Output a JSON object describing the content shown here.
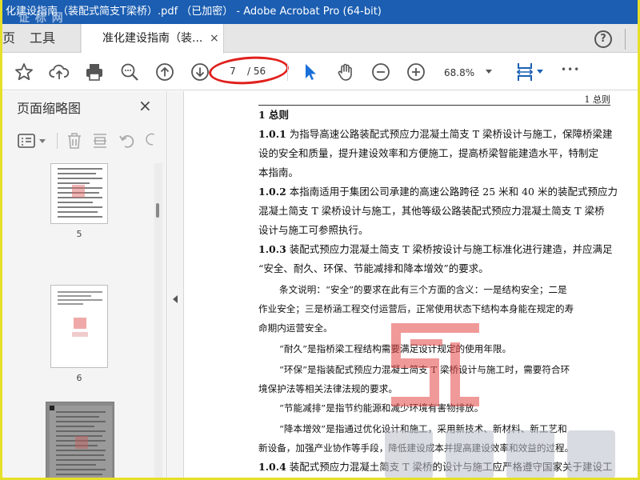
{
  "window": {
    "title": "化建设指南（装配式简支T梁桥）.pdf （已加密） - Adobe Acrobat Pro (64-bit)",
    "watermark": "证 标 网"
  },
  "tabs": {
    "home_label": "页",
    "tools_label": "工具",
    "doc_label": "准化建设指南（装...",
    "close_glyph": "×",
    "help_glyph": "?"
  },
  "toolbar": {
    "icons": [
      "star-icon",
      "upload-icon",
      "print-icon",
      "zoom-search-icon",
      "page-up-icon",
      "page-down-icon",
      "select-arrow-icon",
      "hand-icon",
      "zoom-out-icon",
      "zoom-in-icon",
      "fit-page-icon",
      "more-icon"
    ],
    "page_current": "7",
    "page_total": "/ 56",
    "zoom": "68.8%",
    "more_glyph": "•••"
  },
  "left_panel": {
    "title": "页面缩略图",
    "close_glyph": "×",
    "thumbnails": [
      {
        "label": "5"
      },
      {
        "label": "6"
      },
      {
        "label": ""
      }
    ]
  },
  "document": {
    "running_head": "1  总则",
    "heading": "1 总则",
    "lines": [
      {
        "num": "1.0.1",
        "text": " 为指导高速公路装配式预应力混凝土简支 T 梁桥设计与施工，保障桥梁建"
      },
      {
        "num": "",
        "text": "设的安全和质量，提升建设效率和方便施工，提高桥梁智能建造水平，特制定"
      },
      {
        "num": "",
        "text": "本指南。"
      },
      {
        "num": "1.0.2",
        "text": " 本指南适用于集团公司承建的高速公路跨径 25 米和 40 米的装配式预应力"
      },
      {
        "num": "",
        "text": "混凝土简支 T 梁桥设计与施工，其他等级公路装配式预应力混凝土简支 T 梁桥"
      },
      {
        "num": "",
        "text": "设计与施工可参照执行。"
      },
      {
        "num": "1.0.3",
        "text": " 装配式预应力混凝土简支 T 梁桥按设计与施工标准化进行建造，并应满足"
      },
      {
        "num": "",
        "text": "“安全、耐久、环保、节能减排和降本增效”的要求。"
      }
    ],
    "commentary": [
      "条文说明：“安全”的要求在此有三个方面的含义：一是结构安全；二是",
      "作业安全；三是桥涵工程交付运营后，正常使用状态下结构本身能在规定的寿",
      "命期内运营安全。",
      "“耐久”是指桥梁工程结构需要满足设计规定的使用年限。",
      "“环保”是指装配式预应力混凝土简支 T 梁桥设计与施工时，需要符合环",
      "境保护法等相关法律法规的要求。",
      "“节能减排”是指节约能源和减少环境有害物排放。",
      "“降本增效”是指通过优化设计和施工，采用新技术、新材料、新工艺和",
      "新设备，加强产业协作等手段，降低建设成本并提高建设效率和效益的过程。"
    ],
    "last_line": {
      "num": "1.0.4",
      "text": " 装配式预应力混凝土简支 T 梁桥的设计与施工应严格遵守国家关于建设工"
    },
    "site_watermark": "关于建设工"
  },
  "colors": {
    "titlebar": "#1b5eb2",
    "border": "#e5df29",
    "annotation_oval": "#e0201c",
    "accent_arrow": "#1a6fd8"
  }
}
